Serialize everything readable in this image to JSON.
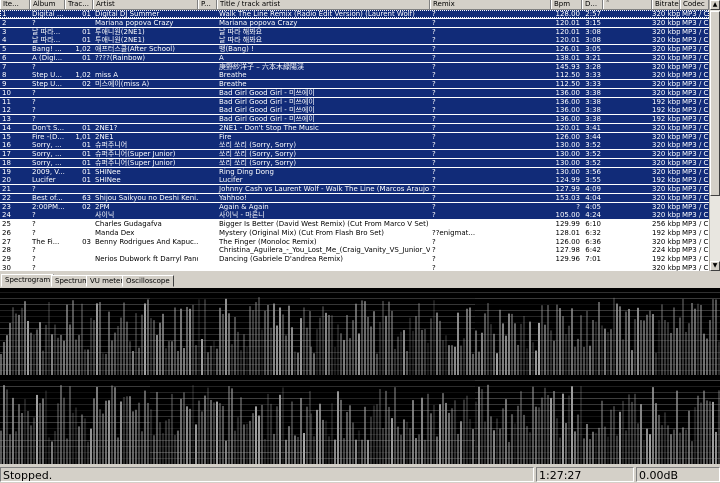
{
  "columns": [
    "Ite...",
    "Album",
    "Trac...",
    "Artist",
    "P...",
    "Title / track artist",
    "Remix",
    "Bpm",
    "D...",
    "˜",
    "Bitrate",
    "Codec"
  ],
  "rows": [
    [
      "1",
      "Digital ...",
      "01",
      "Digital DJ Summer",
      "",
      "Walk The Line Remix (Radio Edit Version) (Laurent Wolf)",
      "?",
      "128.00",
      "2:57",
      "",
      "320 kbps",
      "MP3 / C"
    ],
    [
      "2",
      "?",
      "",
      "Mariana popova   Crazy",
      "",
      "Mariana popova   Crazy",
      "?",
      "120.01",
      "3:15",
      "",
      "320 kbps",
      "MP3 / C"
    ],
    [
      "3",
      "날 따라...",
      "01",
      "투애니원(2NE1)",
      "",
      "날 따라 해봐요",
      "?",
      "120.01",
      "3:08",
      "",
      "320 kbps",
      "MP3 / C"
    ],
    [
      "4",
      "날 따라...",
      "01",
      "투애니원(2NE1)",
      "",
      "날 따라 해봐요",
      "?",
      "120.01",
      "3:08",
      "",
      "320 kbps",
      "MP3 / C"
    ],
    [
      "5",
      "Bang! ...",
      "1,02",
      "애프터스쿨(After School)",
      "",
      "뱅(Bang) !",
      "?",
      "126.01",
      "3:05",
      "",
      "320 kbps",
      "MP3 / C"
    ],
    [
      "6",
      "A (Digi...",
      "01",
      "????(Rainbow)",
      "",
      "A",
      "?",
      "138.01",
      "3:21",
      "",
      "320 kbps",
      "MP3 / C"
    ],
    [
      "7",
      "?",
      "",
      "",
      "",
      "庚野紗洋子 – 六本木緑陽渓",
      "?",
      "145.93",
      "3:28",
      "",
      "320 kbps",
      "MP3 / C"
    ],
    [
      "8",
      "Step U...",
      "1,02",
      "miss A",
      "",
      "Breathe",
      "?",
      "112.50",
      "3:33",
      "",
      "320 kbps",
      "MP3 / C"
    ],
    [
      "9",
      "Step U...",
      "02",
      "미스에이(miss A)",
      "",
      "Breathe",
      "?",
      "112.50",
      "3:33",
      "",
      "320 kbps",
      "MP3 / C"
    ],
    [
      "10",
      "?",
      "",
      "",
      "",
      "Bad Girl Good Girl - 미쓰에이",
      "?",
      "136.00",
      "3:38",
      "",
      "320 kbps",
      "MP3 / C"
    ],
    [
      "11",
      "?",
      "",
      "",
      "",
      "Bad Girl Good Girl - 미쓰에이",
      "?",
      "136.00",
      "3:38",
      "",
      "192 kbps",
      "MP3 / C"
    ],
    [
      "12",
      "?",
      "",
      "",
      "",
      "Bad Girl Good Girl - 미쓰에이",
      "?",
      "136.00",
      "3:38",
      "",
      "192 kbps",
      "MP3 / C"
    ],
    [
      "13",
      "?",
      "",
      "",
      "",
      "Bad Girl Good Girl - 미쓰에이",
      "?",
      "136.00",
      "3:38",
      "",
      "192 kbps",
      "MP3 / C"
    ],
    [
      "14",
      "Don't S...",
      "01",
      "2NE1?",
      "",
      "2NE1 - Don't Stop The Music",
      "?",
      "120.01",
      "3:41",
      "",
      "320 kbps",
      "MP3 / C"
    ],
    [
      "15",
      "Fire -(D...",
      "1,01",
      "2NE1",
      "",
      "Fire",
      "?",
      "126.00",
      "3:44",
      "",
      "320 kbps",
      "MP3 / C"
    ],
    [
      "16",
      "Sorry, ...",
      "01",
      "슈퍼주니어",
      "",
      "쏘리 쏘리 (Sorry, Sorry)",
      "?",
      "130.00",
      "3:52",
      "",
      "320 kbps",
      "MP3 / C"
    ],
    [
      "17",
      "Sorry, ...",
      "01",
      "슈퍼주니어(Super Junior)",
      "",
      "쏘리 쏘리 (Sorry, Sorry)",
      "?",
      "130.00",
      "3:52",
      "",
      "320 kbps",
      "MP3 / C"
    ],
    [
      "18",
      "Sorry, ...",
      "01",
      "슈퍼주니어(Super Junior)",
      "",
      "쏘리 쏘리 (Sorry, Sorry)",
      "?",
      "130.00",
      "3:52",
      "",
      "320 kbps",
      "MP3 / C"
    ],
    [
      "19",
      "2009, V...",
      "01",
      "SHINee",
      "",
      "Ring Ding Dong",
      "?",
      "130.00",
      "3:56",
      "",
      "320 kbps",
      "MP3 / C"
    ],
    [
      "20",
      "Lucifer",
      "01",
      "SHINee",
      "",
      "Lucifer",
      "?",
      "124.99",
      "3:55",
      "",
      "192 kbps",
      "MP3 / C"
    ],
    [
      "21",
      "?",
      "",
      "",
      "",
      "Johnny Cash vs Laurent Wolf - Walk The Line (Marcos Araujo ...",
      "?",
      "127.99",
      "4:09",
      "",
      "320 kbps",
      "MP3 / C"
    ],
    [
      "22",
      "Best of...",
      "63",
      "Shijou Saikyou no Deshi Keni...",
      "",
      "Yahhoo!",
      "?",
      "153.03",
      "4:04",
      "",
      "320 kbps",
      "MP3 / C"
    ],
    [
      "23",
      "2:00PM...",
      "02",
      "2PM",
      "",
      "Again & Again",
      "?",
      "?",
      "4:05",
      "",
      "320 kbps",
      "MP3 / C"
    ],
    [
      "24",
      "?",
      "",
      "사이닉",
      "",
      "사이닉 - 마론니",
      "?",
      "105.00",
      "4:24",
      "",
      "320 kbps",
      "MP3 / C"
    ],
    [
      "25",
      "?",
      "",
      "Charles Gudagafva",
      "",
      "Bigger Is Better (David West Remix) (Cut From Marco V Set)",
      "",
      "129.99",
      "6:10",
      "",
      "256 kbps",
      "MP3 / C"
    ],
    [
      "26",
      "?",
      "",
      "Manda Dex",
      "",
      "Mystery (Original Mix) (Cut From Flash Bro Set)",
      "??enigmat...",
      "128.01",
      "6:32",
      "",
      "192 kbps",
      "MP3 / C"
    ],
    [
      "27",
      "The Fi...",
      "03",
      "Benny Rodrigues And Kapuc...",
      "",
      "The Finger (Monoloc Remix)",
      "?",
      "126.00",
      "6:36",
      "",
      "320 kbps",
      "MP3 / C"
    ],
    [
      "28",
      "?",
      "",
      "",
      "",
      "Christina_Aguilera_-_You_Lost_Me_(Craig_Vanity_VS_Junior_V...",
      "?",
      "127.98",
      "6:42",
      "",
      "224 kbps",
      "MP3 / C"
    ],
    [
      "29",
      "?",
      "",
      "Nerios Dubwork ft Darryl Pandy",
      "",
      "Dancing (Gabriele D'andrea Remix)",
      "?",
      "129.96",
      "7:01",
      "",
      "192 kbps",
      "MP3 / C"
    ],
    [
      "30",
      "?",
      "",
      "",
      "",
      "",
      "?",
      "",
      "",
      "",
      "320 kbps",
      "MP3 / C"
    ]
  ],
  "selected_count": 24,
  "tabs": [
    "Spectrogram",
    "Spectrum",
    "VU meter",
    "Oscilloscope"
  ],
  "active_tab": "Spectrogram",
  "status": {
    "state": "Stopped.",
    "time": "1:27:27",
    "volume": "0.00dB"
  },
  "scroll": {
    "up_glyph": "▲",
    "down_glyph": "▼"
  },
  "colors": {
    "selection": "#112b78",
    "background": "#ffffff",
    "chrome": "#d4d0c8"
  },
  "icons": [
    "up-arrow-icon",
    "down-arrow-icon"
  ]
}
